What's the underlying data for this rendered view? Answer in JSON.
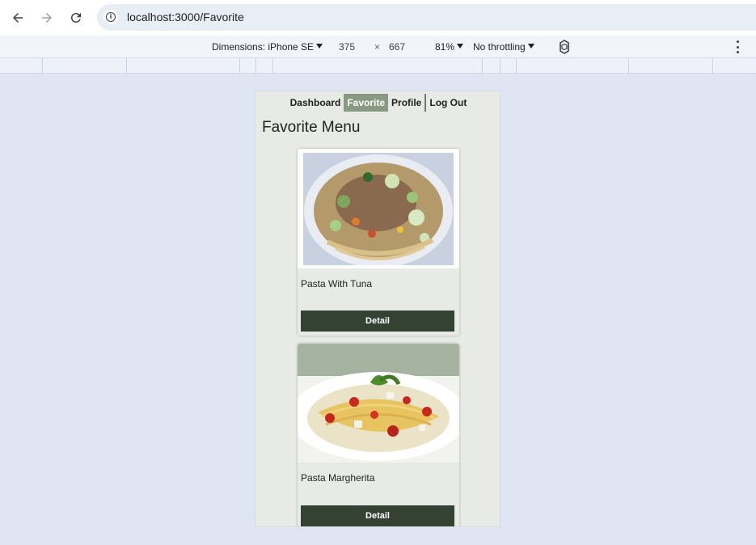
{
  "browser": {
    "url": "localhost:3000/Favorite"
  },
  "device_toolbar": {
    "dimensions_label": "Dimensions: iPhone SE",
    "width": "375",
    "times": "×",
    "height": "667",
    "zoom": "81%",
    "throttling": "No throttling"
  },
  "app": {
    "nav": [
      {
        "label": "Dashboard",
        "active": false
      },
      {
        "label": "Favorite",
        "active": true
      },
      {
        "label": "Profile",
        "active": false
      },
      {
        "label": "Log Out",
        "active": false
      }
    ],
    "page_title": "Favorite Menu",
    "cards": [
      {
        "name": "Pasta With Tuna",
        "button": "Detail"
      },
      {
        "name": "Pasta Margherita",
        "button": "Detail"
      }
    ]
  },
  "colors": {
    "active_nav": "#8a9a82",
    "button_bg": "#344234",
    "app_bg": "#e8eae6",
    "page_bg": "#dfe5f3"
  }
}
